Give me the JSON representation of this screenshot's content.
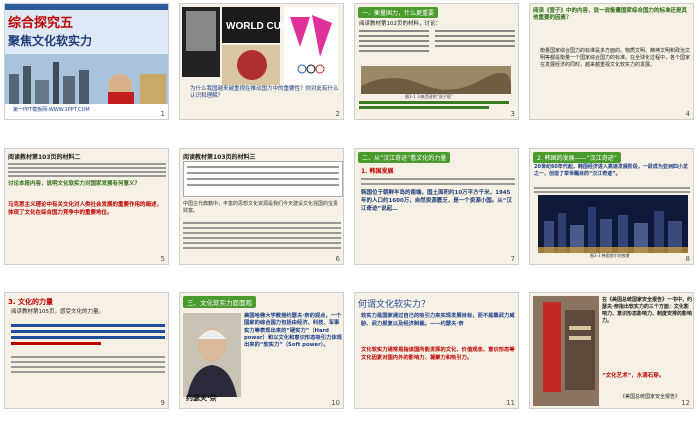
{
  "slides": [
    {
      "num": "1",
      "title": "综合探究五",
      "subtitle": "聚焦文化软实力",
      "footer": "第一PPT模板网-WWW.1PPT.COM"
    },
    {
      "num": "2",
      "worldcup": "WORLD CUP",
      "question": "为什么我国越来越重视在推动国力中的重要性？你对此有什么认识和理解？"
    },
    {
      "num": "3",
      "header": "一、衡量国力，什么更重要",
      "task": "阅读教材第102页的材料，讨论：",
      "caption": "图3-1 马来西亚的“双子塔”"
    },
    {
      "num": "4",
      "head": "阅读《管子》中的内容，说一说衡量国家综合国力的标准还是其他重要的因素？",
      "body": "衡量国家综合国力的标准是多方面的。物质文明、精神文明和政治文明等都是衡量一个国家综合国力的标准。在全球化过程中，各个国家在发展经济的同时，越来越重视文化软实力的发展。"
    },
    {
      "num": "5",
      "header": "阅读教材第103页的材料二",
      "q": "讨论本段内容，说明文化软实力对国家发展有何意义？",
      "body": "马克思主义理论中有关文化对人类社会发展的重要作用的阐述，体现了文化在综合国力竞争中的重要地位。"
    },
    {
      "num": "6",
      "header": "阅读教材第103页的材料三",
      "body": "中国古代典籍中，丰富的思想文化资源是我们今天建设文化强国的宝贵财富。"
    },
    {
      "num": "7",
      "header": "二、从“汉江奇迹”看文化的力量",
      "sub": "1. 韩国发展",
      "body": "韩国位于朝鲜半岛的南端，国土面积约10万平方千米，1945年的人口约1600万，自然资源匮乏，是一个资源小国。从“汉江奇迹”说起…"
    },
    {
      "num": "8",
      "header": "2. 韩国的发展——“汉江奇迹”",
      "body": "20世纪60年代起，韩国经济进入高速发展阶段，一跃成为亚洲四小龙之一，创造了举世瞩目的“汉江奇迹”。",
      "caption": "图3-3 韩国首尔的夜景"
    },
    {
      "num": "9",
      "header": "3. 文化的力量",
      "body": "阅读教材第105页，感受文化的力量。"
    },
    {
      "num": "10",
      "header": "三、文化软实力面面观",
      "body": "美国哈佛大学教授约瑟夫·奈的观点，一个国家的综合国力包括由经济、科技、军事实力等表现出来的“硬实力”（Hard power）和以文化和意识形态吸引力体现出来的“软实力”（Soft power）。",
      "name": "约瑟夫·奈"
    },
    {
      "num": "11",
      "header": "何谓文化软实力？",
      "body": "软实力是国家通过自己的吸引力来实现发展目标，而不是靠武力威胁、武力报复以及经济制裁。——约瑟夫·奈",
      "body2": "文化软实力通常是指该国所能发挥的文化、价值观念、意识形态等文化因素对国内外的影响力、凝聚力和吸引力。"
    },
    {
      "num": "12",
      "body": "在《美国总统国家安全报告》一书中，约瑟夫·奈指出软实力的三个方面：文化影响力、意识形态影响力、制度安排的影响力。",
      "quote": "“文化艺术”，水滴石穿。",
      "sub": "《美国总统国家安全报告》"
    }
  ],
  "colors": {
    "green": "#4a9a2c",
    "dark_green": "#2f6e1a",
    "blue": "#1a3e8a",
    "red": "#c00000",
    "orange": "#e07000",
    "slide_bg": "#f6f1e4"
  }
}
